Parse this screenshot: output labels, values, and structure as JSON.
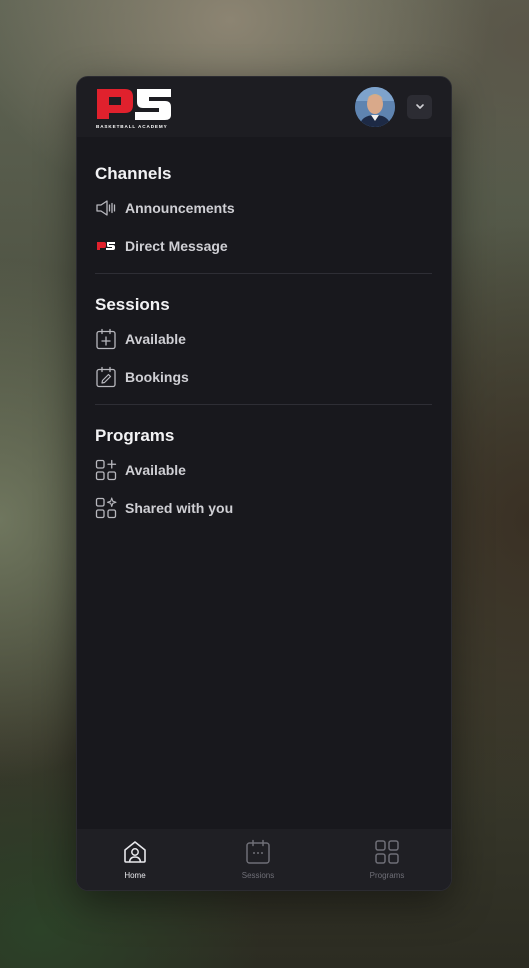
{
  "header": {
    "logo_alt": "PS Basketball Academy",
    "logo_text": "PS",
    "logo_subtext": "BASKETBALL ACADEMY",
    "avatar_icon": "user-avatar",
    "dropdown_icon": "chevron-down-icon"
  },
  "channels": {
    "title": "Channels",
    "items": [
      {
        "label": "Announcements",
        "icon": "megaphone-icon"
      },
      {
        "label": "Direct Message",
        "icon": "ps-logo-icon"
      }
    ]
  },
  "sessions": {
    "title": "Sessions",
    "items": [
      {
        "label": "Available",
        "icon": "calendar-plus-icon"
      },
      {
        "label": "Bookings",
        "icon": "calendar-edit-icon"
      }
    ]
  },
  "programs": {
    "title": "Programs",
    "items": [
      {
        "label": "Available",
        "icon": "grid-plus-icon"
      },
      {
        "label": "Shared with you",
        "icon": "grid-sparkle-icon"
      }
    ]
  },
  "bottom_nav": [
    {
      "label": "Home",
      "icon": "home-icon",
      "active": true
    },
    {
      "label": "Sessions",
      "icon": "calendar-icon",
      "active": false
    },
    {
      "label": "Programs",
      "icon": "grid-icon",
      "active": false
    }
  ],
  "colors": {
    "background": "#18181d",
    "brand_red": "#e0212d",
    "text_primary": "#f2f2f4",
    "text_secondary": "#cfcfd4",
    "nav_inactive": "#6f6f77"
  }
}
